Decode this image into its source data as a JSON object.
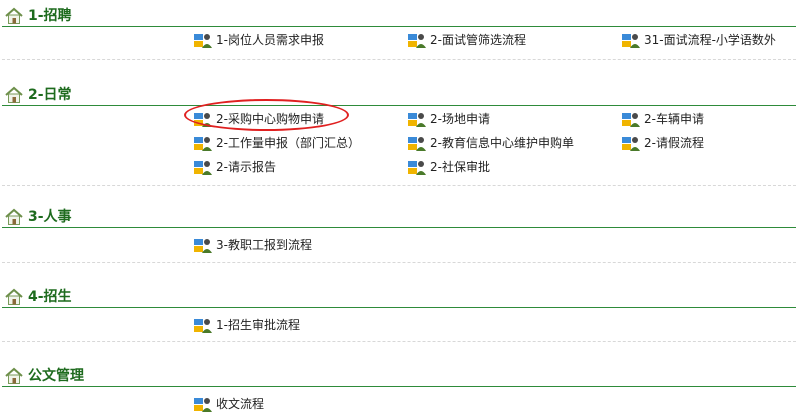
{
  "sections": [
    {
      "title": "1-招聘",
      "items": [
        "1-岗位人员需求申报",
        "2-面试管筛选流程",
        "31-面试流程-小学语数外"
      ]
    },
    {
      "title": "2-日常",
      "items": [
        "2-采购中心购物申请",
        "2-场地申请",
        "2-车辆申请",
        "2-工作量申报（部门汇总）",
        "2-教育信息中心维护申购单",
        "2-请假流程",
        "2-请示报告",
        "2-社保审批"
      ]
    },
    {
      "title": "3-人事",
      "items": [
        "3-教职工报到流程"
      ]
    },
    {
      "title": "4-招生",
      "items": [
        "1-招生审批流程"
      ]
    },
    {
      "title": "公文管理",
      "items": [
        "收文流程"
      ]
    }
  ],
  "icons": {
    "section": "home-icon",
    "item": "workflow-user-icon"
  },
  "colors": {
    "title": "#1e6b1e",
    "rule": "#2e8b3a",
    "highlight": "#e02020"
  }
}
